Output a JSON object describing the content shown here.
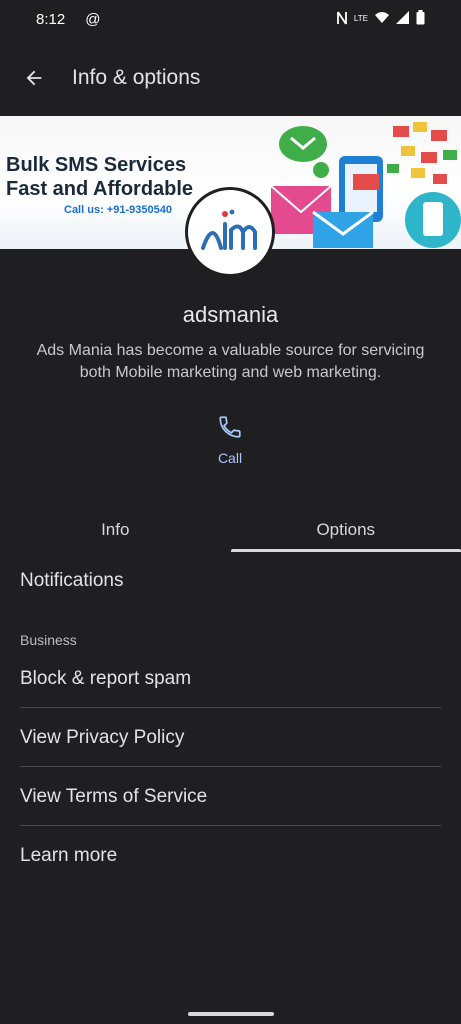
{
  "status_bar": {
    "time": "8:12",
    "at_symbol": "@",
    "network_label": "LTE"
  },
  "app_bar": {
    "title": "Info & options"
  },
  "banner": {
    "line1": "Bulk SMS Services",
    "line2": "Fast and Affordable",
    "phone": "Call us: +91-9350540"
  },
  "business": {
    "name": "adsmania",
    "description": "Ads Mania has become a valuable source for servicing both Mobile marketing and web marketing."
  },
  "call_action": {
    "label": "Call"
  },
  "tabs": [
    {
      "label": "Info",
      "active": false
    },
    {
      "label": "Options",
      "active": true
    }
  ],
  "options": {
    "notifications": "Notifications",
    "section_business": "Business",
    "block_report": "Block & report spam",
    "privacy_policy": "View Privacy Policy",
    "terms_of_service": "View Terms of Service",
    "learn_more": "Learn more"
  },
  "colors": {
    "background": "#1f1f21",
    "accent": "#a8c7fa",
    "text": "#e3e3e3"
  }
}
